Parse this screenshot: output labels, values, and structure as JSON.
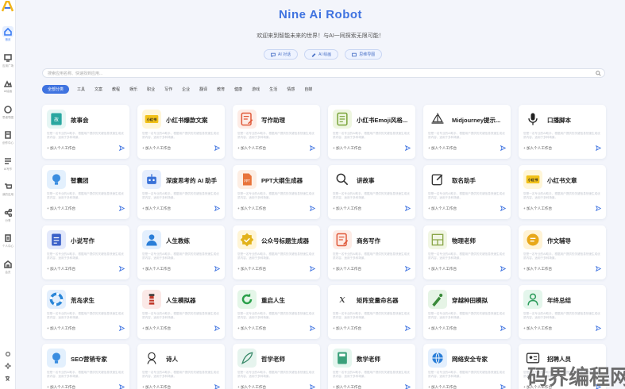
{
  "header": {
    "title": "Nine Ai Robot",
    "subtitle": "欢迎来到智能未来的世界！与AI一同探索无限可能！",
    "pills": [
      "AI 对话",
      "AI 绘画",
      "思维导图"
    ]
  },
  "search": {
    "placeholder": "搜索应用名称、快速找到应用..."
  },
  "tags": [
    "全部分类",
    "工具",
    "文案",
    "教程",
    "娱乐",
    "职业",
    "写作",
    "企业",
    "翻译",
    "教育",
    "健康",
    "游戏",
    "生活",
    "情感",
    "自媒"
  ],
  "card_add_label": "加入个人工作台",
  "card_desc_text": "您是一名专业的AI助手，根据用户提供的关键信息快速生成优质内容，适用于多种场景。",
  "cards": [
    {
      "title": "故事会",
      "icon": "book-icon",
      "color": "#2aa7a0",
      "bg": "#e6f6f4"
    },
    {
      "title": "小红书爆款文案",
      "icon": "redbook-icon",
      "color": "#c79a1a",
      "bg": "#fff6d8"
    },
    {
      "title": "写作助理",
      "icon": "pen-note-icon",
      "color": "#e05a3a",
      "bg": "#fdece6"
    },
    {
      "title": "小红书Emoji风格...",
      "icon": "notebook-icon",
      "color": "#7aa43a",
      "bg": "#eef6e0"
    },
    {
      "title": "Midjourney提示...",
      "icon": "sailboat-icon",
      "color": "#333333",
      "bg": "#ffffff"
    },
    {
      "title": "口播脚本",
      "icon": "microphone-icon",
      "color": "#222222",
      "bg": "#ffffff"
    },
    {
      "title": "智囊团",
      "icon": "lightbulb-icon",
      "color": "#3a8de0",
      "bg": "#e3f0fd"
    },
    {
      "title": "深度思考的 AI 助手",
      "icon": "robot-icon",
      "color": "#3a72d8",
      "bg": "#e6eefd"
    },
    {
      "title": "PPT大纲生成器",
      "icon": "ppt-icon",
      "color": "#e8733a",
      "bg": "#fdeee4"
    },
    {
      "title": "讲故事",
      "icon": "magnifier-icon",
      "color": "#333333",
      "bg": "#ffffff"
    },
    {
      "title": "取名助手",
      "icon": "edit-box-icon",
      "color": "#333333",
      "bg": "#ffffff"
    },
    {
      "title": "小红书文章",
      "icon": "redbook-icon",
      "color": "#c79a1a",
      "bg": "#fff6d8"
    },
    {
      "title": "小说写作",
      "icon": "document-icon",
      "color": "#3a60c8",
      "bg": "#e3e9fb"
    },
    {
      "title": "人生教练",
      "icon": "person-icon",
      "color": "#2a7ed8",
      "bg": "#e3effd"
    },
    {
      "title": "公众号标题生成器",
      "icon": "badge-icon",
      "color": "#e2b21a",
      "bg": "#fff5d6"
    },
    {
      "title": "商务写作",
      "icon": "pen-note-icon",
      "color": "#e05a3a",
      "bg": "#fdece6"
    },
    {
      "title": "物理老师",
      "icon": "layout-icon",
      "color": "#8aa64a",
      "bg": "#f1f6e4"
    },
    {
      "title": "作文辅导",
      "icon": "text-lines-icon",
      "color": "#e8a81a",
      "bg": "#fff3d6"
    },
    {
      "title": "荒岛求生",
      "icon": "lifebuoy-icon",
      "color": "#2a86d8",
      "bg": "#e3effd"
    },
    {
      "title": "人生模拟器",
      "icon": "lighthouse-icon",
      "color": "#c0392b",
      "bg": "#fbe9e7"
    },
    {
      "title": "重启人生",
      "icon": "restart-icon",
      "color": "#2aa04a",
      "bg": "#e4f6e8"
    },
    {
      "title": "矩阵变量命名器",
      "icon": "variable-icon",
      "color": "#333333",
      "bg": "#ffffff"
    },
    {
      "title": "穿越种田模拟",
      "icon": "farmer-icon",
      "color": "#3a8a3a",
      "bg": "#e6f4e6"
    },
    {
      "title": "年终总结",
      "icon": "user-outline-icon",
      "color": "#2a9a5a",
      "bg": "#e4f6ec"
    },
    {
      "title": "SEO营销专家",
      "icon": "lightbulb-icon",
      "color": "#3a8de0",
      "bg": "#e3f0fd"
    },
    {
      "title": "诗人",
      "icon": "poet-icon",
      "color": "#333333",
      "bg": "#ffffff"
    },
    {
      "title": "哲学老师",
      "icon": "feather-icon",
      "color": "#3a8a6a",
      "bg": "#e6f4ee"
    },
    {
      "title": "数学老师",
      "icon": "calculator-icon",
      "color": "#3aa07a",
      "bg": "#e4f6ee"
    },
    {
      "title": "网络安全专家",
      "icon": "globe-icon",
      "color": "#2a7ed8",
      "bg": "#e3effd"
    },
    {
      "title": "招聘人员",
      "icon": "id-card-icon",
      "color": "#333333",
      "bg": "#ffffff"
    }
  ],
  "sidebar": [
    "首页",
    "应用广场",
    "AI绘画",
    "思维导图",
    "创作中心",
    "AI写作",
    "我的应用",
    "分享",
    "个人中心",
    "会员"
  ],
  "watermark": "码界编程网"
}
